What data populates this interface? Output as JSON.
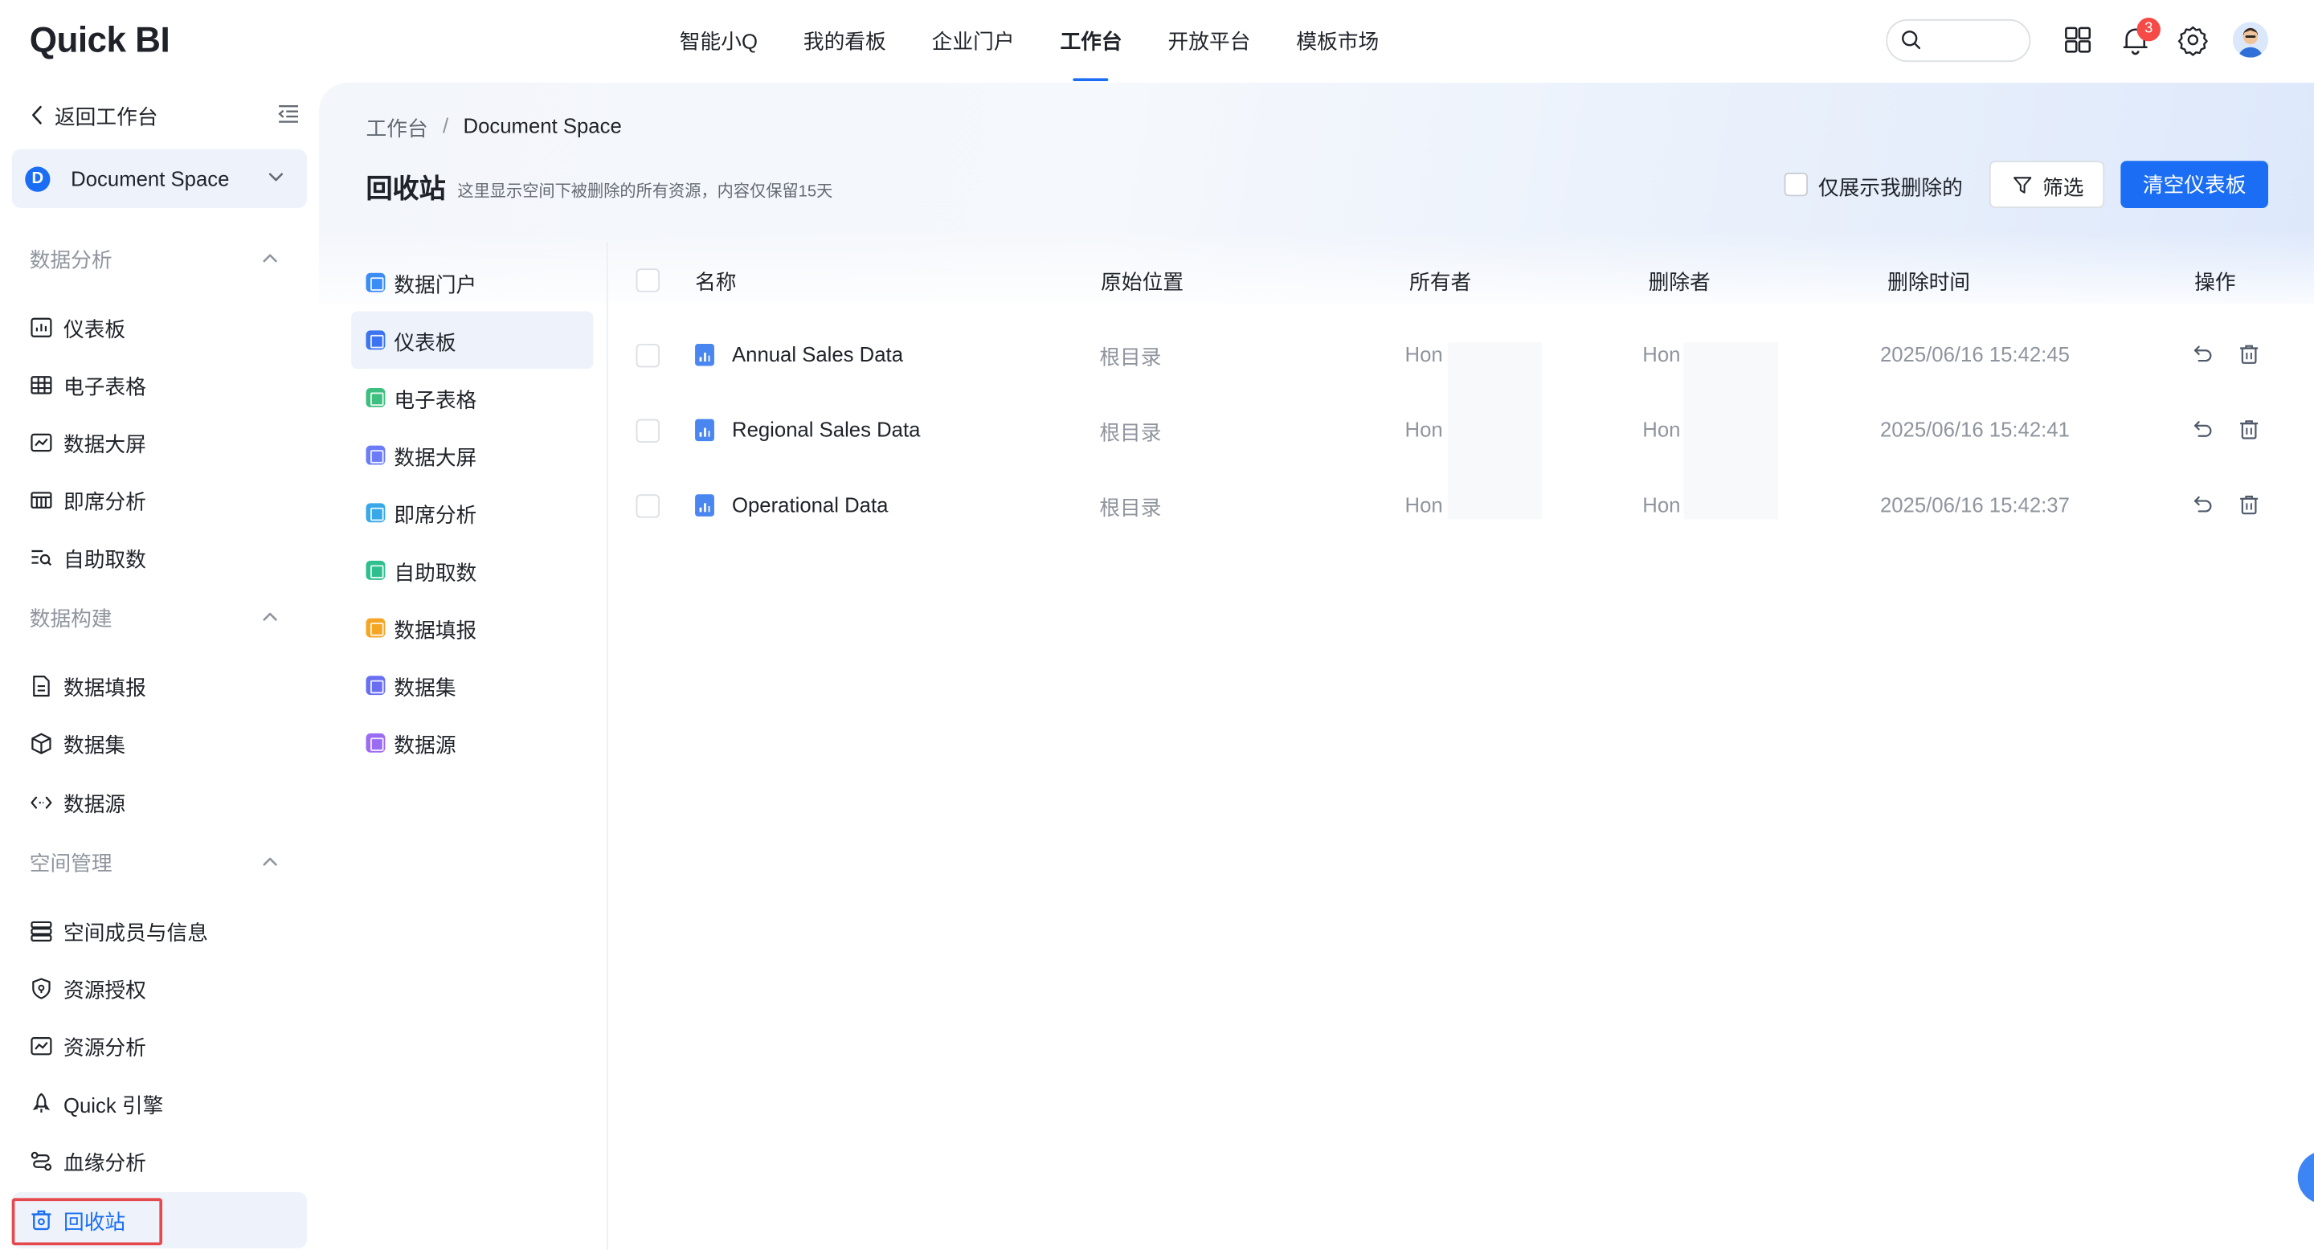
{
  "app": {
    "logo": "Quick BI",
    "brand_color": "#1b6ef3",
    "notification_count": "3"
  },
  "top_nav": {
    "items": [
      "智能小Q",
      "我的看板",
      "企业门户",
      "工作台",
      "开放平台",
      "模板市场"
    ],
    "active_index": 3
  },
  "search": {
    "placeholder": "",
    "icon": "search-icon"
  },
  "top_icons": [
    "apps-grid-icon",
    "bell-icon",
    "gear-icon",
    "user-avatar"
  ],
  "sidebar": {
    "back_label": "返回工作台",
    "space": {
      "initial": "D",
      "name": "Document Space"
    },
    "groups": [
      {
        "title": "数据分析",
        "items": [
          {
            "label": "仪表板",
            "icon": "dashboard-icon"
          },
          {
            "label": "电子表格",
            "icon": "table-icon"
          },
          {
            "label": "数据大屏",
            "icon": "screen-icon"
          },
          {
            "label": "即席分析",
            "icon": "adhoc-icon"
          },
          {
            "label": "自助取数",
            "icon": "self-fetch-icon"
          }
        ]
      },
      {
        "title": "数据构建",
        "items": [
          {
            "label": "数据填报",
            "icon": "form-icon"
          },
          {
            "label": "数据集",
            "icon": "cube-icon"
          },
          {
            "label": "数据源",
            "icon": "code-icon"
          }
        ]
      },
      {
        "title": "空间管理",
        "items": [
          {
            "label": "空间成员与信息",
            "icon": "members-icon"
          },
          {
            "label": "资源授权",
            "icon": "shield-icon"
          },
          {
            "label": "资源分析",
            "icon": "analysis-icon"
          },
          {
            "label": "Quick 引擎",
            "icon": "rocket-icon"
          },
          {
            "label": "血缘分析",
            "icon": "lineage-icon"
          },
          {
            "label": "回收站",
            "icon": "trash-bin-icon",
            "active": true
          }
        ]
      }
    ]
  },
  "main": {
    "breadcrumb": [
      "工作台",
      "/",
      "Document Space"
    ],
    "title": "回收站",
    "description": "这里显示空间下被删除的所有资源，内容仅保留15天",
    "only_mine_label": "仅展示我删除的",
    "filter_label": "筛选",
    "clear_button": "清空仪表板",
    "types": [
      {
        "label": "数据门户",
        "color": "#3b8cf5"
      },
      {
        "label": "仪表板",
        "color": "#3b73f0",
        "active": true
      },
      {
        "label": "电子表格",
        "color": "#3fbf7f"
      },
      {
        "label": "数据大屏",
        "color": "#6b7cf6"
      },
      {
        "label": "即席分析",
        "color": "#38a8e8"
      },
      {
        "label": "自助取数",
        "color": "#2fbf8f"
      },
      {
        "label": "数据填报",
        "color": "#f5a524"
      },
      {
        "label": "数据集",
        "color": "#6a6ff2"
      },
      {
        "label": "数据源",
        "color": "#9b6bf2"
      }
    ],
    "table": {
      "columns": [
        "名称",
        "原始位置",
        "所有者",
        "删除者",
        "删除时间",
        "操作"
      ],
      "rows": [
        {
          "name": "Annual Sales Data",
          "location": "根目录",
          "owner": "Hon",
          "deleter": "Hon",
          "deleted_at": "2025/06/16 15:42:45"
        },
        {
          "name": "Regional Sales Data",
          "location": "根目录",
          "owner": "Hon",
          "deleter": "Hon",
          "deleted_at": "2025/06/16 15:42:41"
        },
        {
          "name": "Operational Data",
          "location": "根目录",
          "owner": "Hon",
          "deleter": "Hon",
          "deleted_at": "2025/06/16 15:42:37"
        }
      ],
      "row_actions": [
        "restore-icon",
        "delete-icon"
      ]
    }
  }
}
